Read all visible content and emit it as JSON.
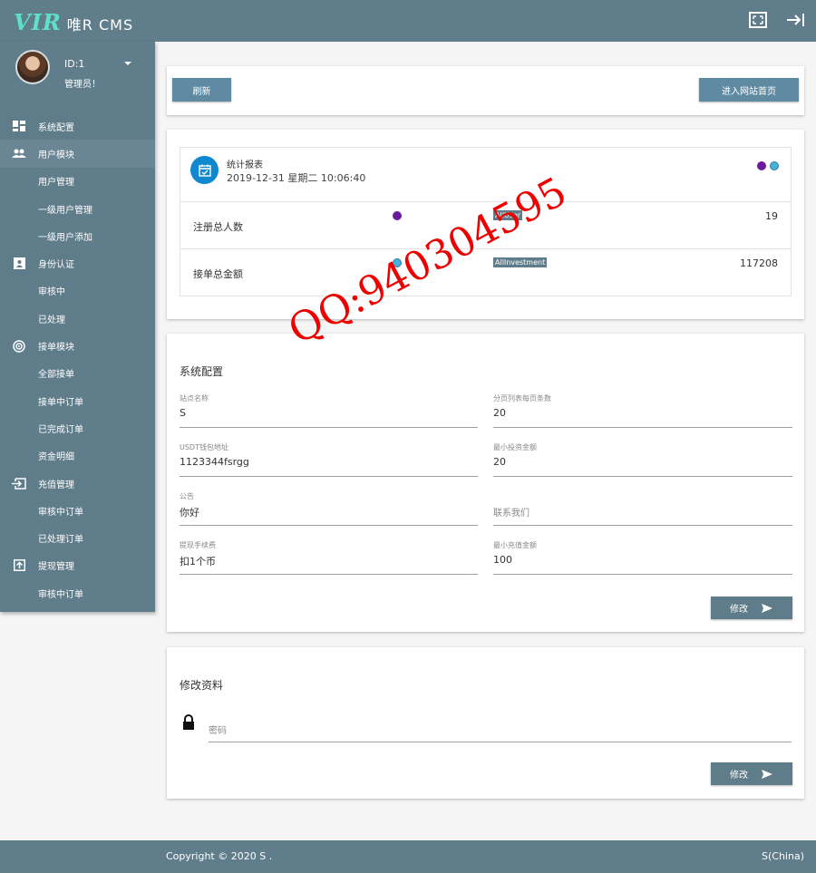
{
  "header": {
    "logo": "VIR",
    "app_name": "唯R CMS",
    "fullscreen_icon": "fullscreen-icon",
    "logout_icon": "logout-icon"
  },
  "profile": {
    "id": "ID:1",
    "role": "管理员！"
  },
  "sidebar": {
    "items": [
      {
        "label": "系统配置",
        "type": "group",
        "icon": "dashboard-icon"
      },
      {
        "label": "用户模块",
        "type": "group",
        "icon": "people-icon"
      },
      {
        "label": "用户管理",
        "type": "sub"
      },
      {
        "label": "一级用户管理",
        "type": "sub"
      },
      {
        "label": "一级用户添加",
        "type": "sub"
      },
      {
        "label": "身份认证",
        "type": "group",
        "icon": "id-card-icon"
      },
      {
        "label": "审核中",
        "type": "sub"
      },
      {
        "label": "已处理",
        "type": "sub"
      },
      {
        "label": "接单模块",
        "type": "group",
        "icon": "radar-icon"
      },
      {
        "label": "全部接单",
        "type": "sub"
      },
      {
        "label": "接单中订单",
        "type": "sub"
      },
      {
        "label": "已完成订单",
        "type": "sub"
      },
      {
        "label": "资金明细",
        "type": "sub"
      },
      {
        "label": "充值管理",
        "type": "group",
        "icon": "login-icon"
      },
      {
        "label": "审核中订单",
        "type": "sub"
      },
      {
        "label": "已处理订单",
        "type": "sub"
      },
      {
        "label": "提现管理",
        "type": "group",
        "icon": "upload-icon"
      },
      {
        "label": "审核中订单",
        "type": "sub"
      }
    ]
  },
  "toolbar": {
    "refresh_label": "刷新",
    "home_label": "进入网站首页"
  },
  "stats": {
    "title": "统计报表",
    "datetime": "2019-12-31   星期二 10:06:40",
    "rows": [
      {
        "label": "注册总人数",
        "tag": "AllUser",
        "value": "19"
      },
      {
        "label": "接单总金额",
        "tag": "AllInvestment",
        "value": "117208"
      }
    ]
  },
  "config": {
    "title": "系统配置",
    "fields": [
      {
        "label": "站点名称",
        "value": "S"
      },
      {
        "label": "分页列表每页条数",
        "value": "20"
      },
      {
        "label": "USDT钱包地址",
        "value": "1123344fsrgg"
      },
      {
        "label": "最小投资金额",
        "value": "20"
      },
      {
        "label": "公告",
        "value": "你好"
      },
      {
        "label": "",
        "placeholder": "联系我们"
      },
      {
        "label": "提现手续费",
        "value": "扣1个币"
      },
      {
        "label": "最小充值金额",
        "value": "100"
      }
    ],
    "submit_label": "修改"
  },
  "profile_edit": {
    "title": "修改资料",
    "password_placeholder": "密码",
    "submit_label": "修改"
  },
  "footer": {
    "copyright": "Copyright © 2020 S .",
    "right": "S(China)"
  },
  "watermark": "QQ:940304595",
  "colors": {
    "primary": "#607d8b",
    "button": "#5f8aa1",
    "accent_logo": "#5fe0c8",
    "calendar_badge": "#0f88d0",
    "watermark": "#ee0000"
  }
}
